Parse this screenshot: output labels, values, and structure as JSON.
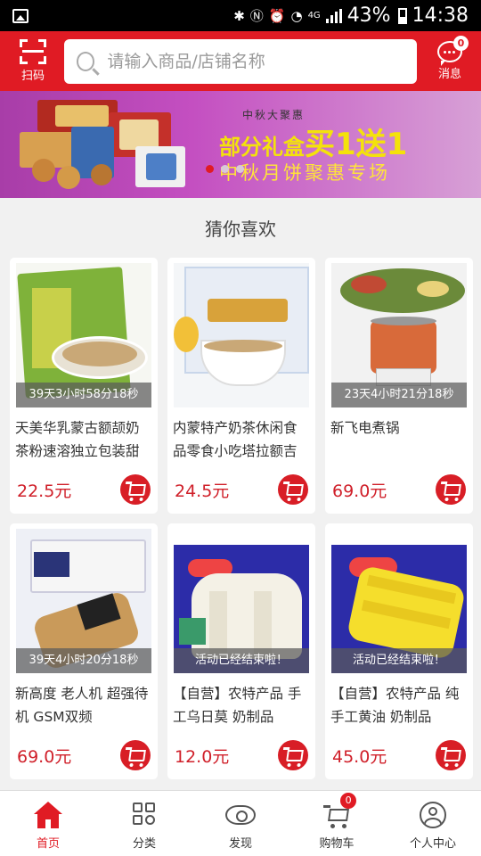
{
  "status_bar": {
    "battery": "43%",
    "time": "14:38",
    "network": "4G"
  },
  "header": {
    "scan_label": "扫码",
    "search_placeholder": "请输入商品/店铺名称",
    "messages_label": "消息",
    "messages_count": "0"
  },
  "banner": {
    "small_text": "中秋大聚惠",
    "promo_prefix": "部分礼盒",
    "promo_main": "买1送1",
    "subtitle": "中秋月饼聚惠专场",
    "slide_count": 3,
    "active_slide": 0
  },
  "section_title": "猜你喜欢",
  "products": [
    {
      "name": "天美华乳蒙古额颉奶茶粉速溶独立包装甜",
      "price": "22.5元",
      "timer": "39天3小时58分18秒",
      "image": "milk-tea-package"
    },
    {
      "name": "内蒙特产奶茶休闲食品零食小吃塔拉额吉",
      "price": "24.5元",
      "timer": "",
      "image": "milk-tea-cup"
    },
    {
      "name": "新飞电煮锅",
      "price": "69.0元",
      "timer": "23天4小时21分18秒",
      "image": "electric-pot"
    },
    {
      "name": "新高度 老人机 超强待机 GSM双频",
      "price": "69.0元",
      "timer": "39天4小时20分18秒",
      "image": "phone"
    },
    {
      "name": "【自营】农特产品 手工乌日莫 奶制品",
      "price": "12.0元",
      "timer": "活动已经结束啦！",
      "image": "dairy-white"
    },
    {
      "name": "【自营】农特产品 纯手工黄油 奶制品",
      "price": "45.0元",
      "timer": "活动已经结束啦！",
      "image": "butter-yellow"
    }
  ],
  "tabs": [
    {
      "label": "首页",
      "icon": "home-icon",
      "active": true
    },
    {
      "label": "分类",
      "icon": "category-icon",
      "active": false
    },
    {
      "label": "发现",
      "icon": "eye-icon",
      "active": false
    },
    {
      "label": "购物车",
      "icon": "cart-icon",
      "active": false,
      "badge": "0"
    },
    {
      "label": "个人中心",
      "icon": "user-icon",
      "active": false
    }
  ],
  "colors": {
    "brand_red": "#e01b24",
    "price_red": "#d0202a"
  }
}
